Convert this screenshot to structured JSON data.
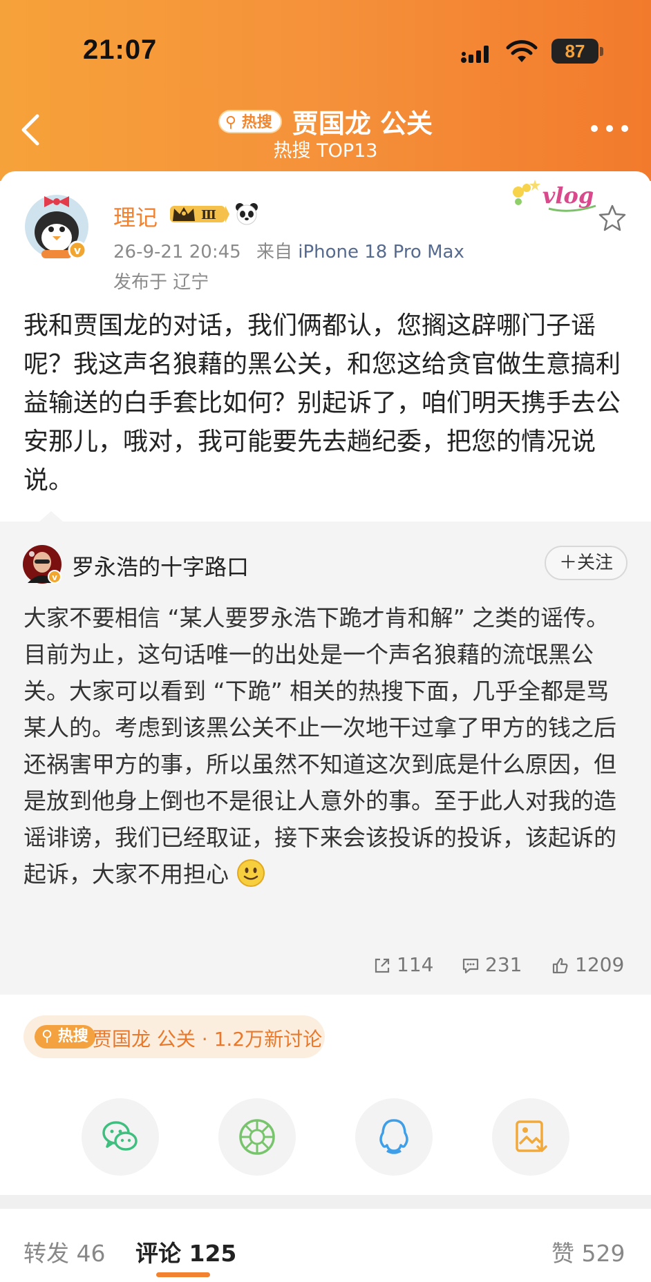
{
  "status": {
    "time": "21:07",
    "battery": "87"
  },
  "nav": {
    "hot_tag": "热搜",
    "title": "贾国龙 公关",
    "subtitle": "热搜 TOP13"
  },
  "post": {
    "author": "理记",
    "vip_level": "Ⅲ",
    "date": "26-9-21 20:45",
    "source_prefix": "来自",
    "device": "iPhone 18 Pro Max",
    "location": "发布于 辽宁",
    "sticker_text": "vlog",
    "body": "我和贾国龙的对话，我们俩都认，您搁这辟哪门子谣呢？我这声名狼藉的黑公关，和您这给贪官做生意搞利益输送的白手套比如何？别起诉了，咱们明天携手去公安那儿，哦对，我可能要先去趟纪委，把您的情况说说。"
  },
  "repost": {
    "author": "罗永浩的十字路口",
    "follow_label": "＋关注",
    "body": "大家不要相信 “某人要罗永浩下跪才肯和解” 之类的谣传。目前为止，这句话唯一的出处是一个声名狼藉的流氓黑公关。大家可以看到 “下跪” 相关的热搜下面，几乎全都是骂某人的。考虑到该黑公关不止一次地干过拿了甲方的钱之后还祸害甲方的事，所以虽然不知道这次到底是什么原因，但是放到他身上倒也不是很让人意外的事。至于此人对我的造谣诽谤，我们已经取证，接下来会该投诉的投诉，该起诉的起诉，大家不用担心",
    "reposts": "114",
    "comments": "231",
    "likes": "1209"
  },
  "topic": {
    "tag": "热搜",
    "text": "贾国龙 公关 · 1.2万新讨论"
  },
  "share": {
    "icons": [
      "wechat-icon",
      "moments-icon",
      "qq-icon",
      "save-image-icon"
    ],
    "colors": {
      "wechat": "#3fbf7f",
      "moments": "#77c46c",
      "qq": "#3f9ee8",
      "save": "#f1a93b"
    }
  },
  "tabs": {
    "repost": "转发 46",
    "comment": "评论 125",
    "like": "赞 529"
  },
  "colors": {
    "accent": "#f28230",
    "header_start": "#f6a23a",
    "header_end": "#f27a2c"
  }
}
